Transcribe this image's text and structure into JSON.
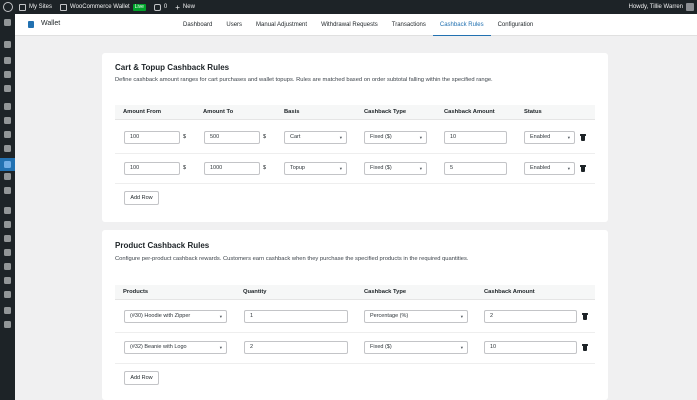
{
  "adminbar": {
    "site_name": "My Sites",
    "site_link": "WooCommerce Wallet",
    "live_badge": "Live",
    "comments_count": "0",
    "new_label": "New",
    "greeting": "Howdy, Tillie Warren"
  },
  "plugin": {
    "title": "Wallet",
    "nav": [
      "Dashboard",
      "Users",
      "Manual Adjustment",
      "Withdrawal Requests",
      "Transactions",
      "Cashback Rules",
      "Configuration"
    ],
    "active_tab": "Cashback Rules"
  },
  "cart_rules": {
    "title": "Cart & Topup Cashback Rules",
    "description": "Define cashback amount ranges for cart purchases and wallet topups. Rules are matched based on order subtotal falling within the specified range.",
    "columns": [
      "Amount From",
      "Amount To",
      "Basis",
      "Cashback Type",
      "Cashback Amount",
      "Status"
    ],
    "currency_symbol": "$",
    "rows": [
      {
        "amount_from": "100",
        "amount_to": "500",
        "basis": "Cart",
        "cashback_type": "Fixed ($)",
        "cashback_amount": "10",
        "status": "Enabled"
      },
      {
        "amount_from": "100",
        "amount_to": "1000",
        "basis": "Topup",
        "cashback_type": "Fixed ($)",
        "cashback_amount": "5",
        "status": "Enabled"
      }
    ],
    "add_row_label": "Add Row"
  },
  "product_rules": {
    "title": "Product Cashback Rules",
    "description": "Configure per-product cashback rewards. Customers earn cashback when they purchase the specified products in the required quantities.",
    "columns": [
      "Products",
      "Quantity",
      "Cashback Type",
      "Cashback Amount"
    ],
    "rows": [
      {
        "product": "(#30) Hoodie with Zipper",
        "quantity": "1",
        "cashback_type": "Percentage (%)",
        "cashback_amount": "2"
      },
      {
        "product": "(#32) Beanie with Logo",
        "quantity": "2",
        "cashback_type": "Fixed ($)",
        "cashback_amount": "10"
      }
    ],
    "add_row_label": "Add Row"
  },
  "colors": {
    "adminbar_bg": "#1d2327",
    "accent": "#2271b1",
    "live_badge": "#00a32a",
    "page_bg": "#f0f0f1"
  }
}
